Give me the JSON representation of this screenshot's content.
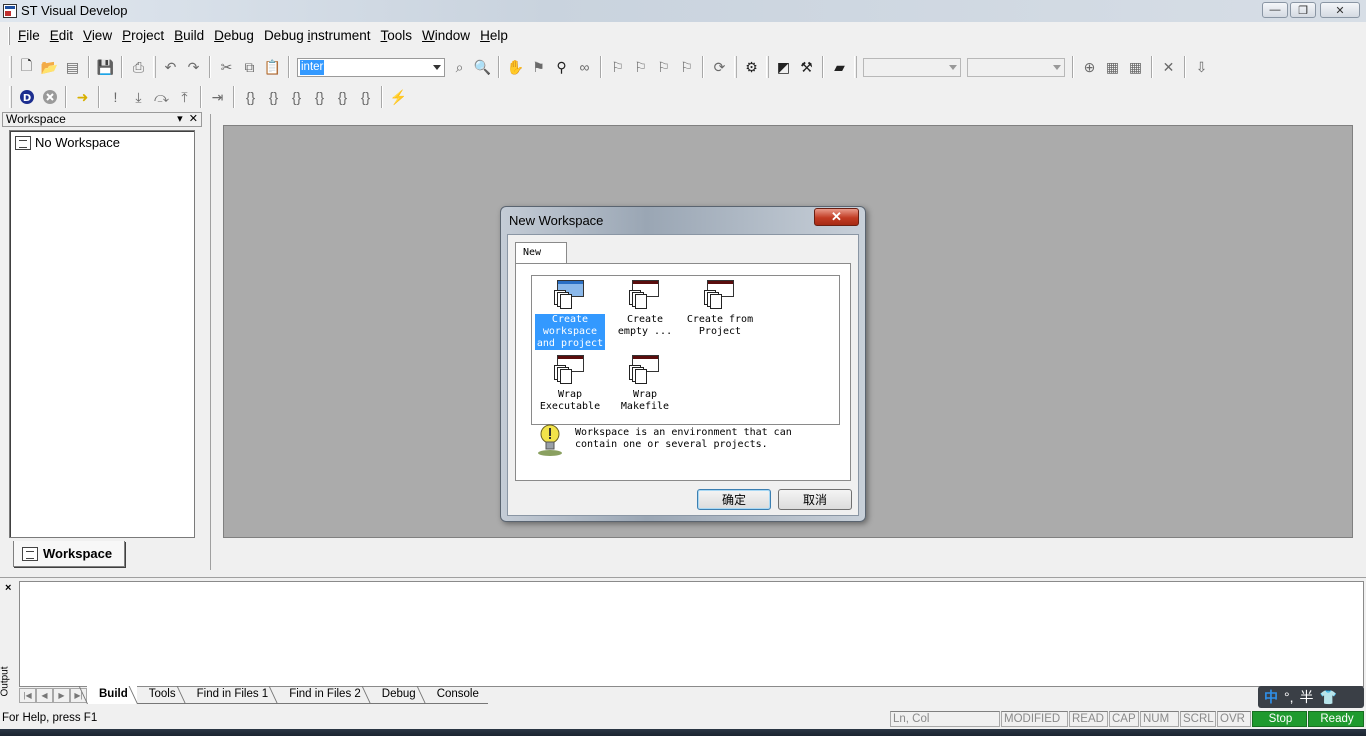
{
  "window": {
    "title": "ST Visual Develop",
    "minimize_glyph": "—",
    "maximize_glyph": "❐",
    "close_glyph": "✕"
  },
  "menu": [
    {
      "label": "File",
      "underline": "F",
      "rest": "ile"
    },
    {
      "label": "Edit",
      "underline": "E",
      "rest": "dit"
    },
    {
      "label": "View",
      "underline": "V",
      "rest": "iew"
    },
    {
      "label": "Project",
      "underline": "P",
      "rest": "roject"
    },
    {
      "label": "Build",
      "underline": "B",
      "rest": "uild"
    },
    {
      "label": "Debug",
      "underline": "D",
      "rest": "ebug"
    },
    {
      "label": "Debug instrument",
      "pre": "Debug ",
      "underline": "i",
      "rest": "nstrument"
    },
    {
      "label": "Tools",
      "underline": "T",
      "rest": "ools"
    },
    {
      "label": "Window",
      "underline": "W",
      "rest": "indow"
    },
    {
      "label": "Help",
      "underline": "H",
      "rest": "elp"
    }
  ],
  "toolbar": {
    "find_combo_value": "inter",
    "config_combo_value": "",
    "target_combo_value": ""
  },
  "workspace_pane": {
    "header": "Workspace",
    "header_dropdown_glyph": "▾",
    "header_close_glyph": "✕",
    "tree_item": "No Workspace",
    "tab_label": "Workspace"
  },
  "dialog": {
    "title": "New Workspace",
    "close_glyph": "✕",
    "tab": "New",
    "items": [
      {
        "label": "Create workspace and project",
        "line1": "Create",
        "line2": "workspace",
        "line3": "and project",
        "selected": true
      },
      {
        "label": "Create empty ...",
        "line1": "Create",
        "line2": "empty ...",
        "line3": "",
        "selected": false
      },
      {
        "label": "Create from Project",
        "line1": "Create from",
        "line2": "Project",
        "line3": "",
        "selected": false
      },
      {
        "label": "Wrap Executable",
        "line1": "Wrap",
        "line2": "Executable",
        "line3": "",
        "selected": false
      },
      {
        "label": "Wrap Makefile",
        "line1": "Wrap",
        "line2": "Makefile",
        "line3": "",
        "selected": false
      }
    ],
    "info_text": "Workspace is an environment that can\ncontain one or several projects.",
    "ok_label": "确定",
    "cancel_label": "取消"
  },
  "output": {
    "side_label": "Output",
    "close_glyph": "×",
    "tabs": [
      "Build",
      "Tools",
      "Find in Files 1",
      "Find in Files 2",
      "Debug",
      "Console"
    ],
    "active_tab": "Build"
  },
  "statusbar": {
    "help": "For Help, press F1",
    "cells": [
      "Ln, Col",
      "MODIFIED",
      "READ",
      "CAP",
      "NUM",
      "SCRL",
      "OVR"
    ],
    "stop": "Stop",
    "ready": "Ready"
  },
  "ime": {
    "lang": "中",
    "punct": "°,",
    "width": "半"
  },
  "colors": {
    "accent_selection": "#3399ff",
    "status_green": "#1f9a2e",
    "mdi_background": "#ababab",
    "dialog_close_red": "#c23c24"
  }
}
